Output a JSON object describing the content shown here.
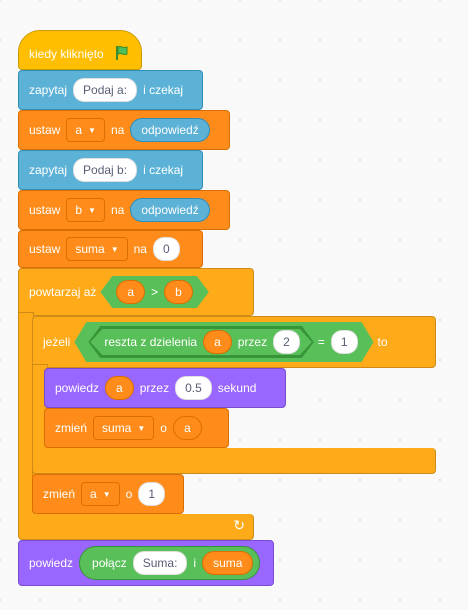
{
  "script": {
    "hat": {
      "label": "kiedy kliknięto",
      "icon": "green-flag-icon"
    },
    "ask1": {
      "label": "zapytaj",
      "input": "Podaj a:",
      "suffix": "i czekaj"
    },
    "set1": {
      "label": "ustaw",
      "variable": "a",
      "connector": "na",
      "reporter": "odpowiedź"
    },
    "ask2": {
      "label": "zapytaj",
      "input": "Podaj b:",
      "suffix": "i czekaj"
    },
    "set2": {
      "label": "ustaw",
      "variable": "b",
      "connector": "na",
      "reporter": "odpowiedź"
    },
    "set3": {
      "label": "ustaw",
      "variable": "suma",
      "connector": "na",
      "value": "0"
    },
    "repeat": {
      "label": "powtarzaj aż",
      "left": "a",
      "op": ">",
      "right": "b"
    },
    "if_block": {
      "label": "jeżeli",
      "mod_label": "reszta z dzielenia",
      "mod_left": "a",
      "mod_by": "przez",
      "mod_right": "2",
      "eq": "=",
      "eq_right": "1",
      "then": "to"
    },
    "say_for": {
      "label": "powiedz",
      "reporter": "a",
      "by": "przez",
      "secs": "0.5",
      "unit": "sekund"
    },
    "change1": {
      "label": "zmień",
      "variable": "suma",
      "connector": "o",
      "reporter": "a"
    },
    "change2": {
      "label": "zmień",
      "variable": "a",
      "connector": "o",
      "value": "1"
    },
    "say_final": {
      "label": "powiedz",
      "join": "połącz",
      "text": "Suma:",
      "and": "i",
      "reporter": "suma"
    }
  },
  "colors": {
    "events": "#ffbf00",
    "control": "#ffab19",
    "sensing": "#5cb1d6",
    "variables": "#ff8c1a",
    "looks": "#9966ff",
    "operators": "#59c059"
  }
}
